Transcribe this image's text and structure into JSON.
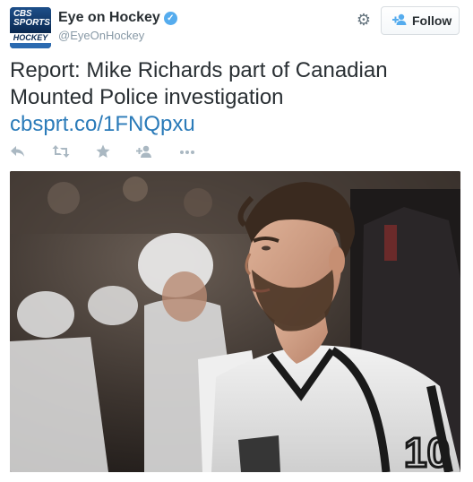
{
  "account": {
    "avatar_logo_line1": "CBS",
    "avatar_logo_line2": "SPORTS",
    "avatar_logo_band": "HOCKEY",
    "name": "Eye on Hockey",
    "handle": "@EyeOnHockey",
    "verified": true
  },
  "follow_button": {
    "label": "Follow"
  },
  "tweet": {
    "text": "Report: Mike Richards part of Canadian Mounted Police investigation",
    "link": "cbsprt.co/1FNQpxu"
  },
  "actions": [
    "reply-icon",
    "retweet-icon",
    "favorite-icon",
    "follow-icon",
    "more-icon"
  ],
  "photo": {
    "jersey_text": "10"
  },
  "colors": {
    "link": "#2b7bb9",
    "verified": "#55acee",
    "text": "#292f33",
    "muted": "#8899a6"
  }
}
